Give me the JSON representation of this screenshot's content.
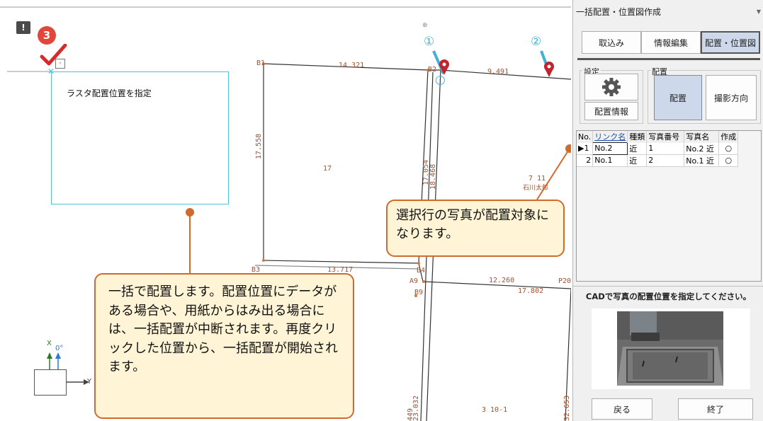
{
  "panel": {
    "title": "一括配置・位置図作成",
    "tabs": [
      "取込み",
      "情報編集",
      "配置・位置図"
    ],
    "settings_group": "設定",
    "placement_group": "配置",
    "placement_info_button": "配置情報",
    "place_button": "配置",
    "shooting_direction_button": "撮影方向",
    "grid": {
      "headers": [
        "No.",
        "リンク名",
        "種類",
        "写真番号",
        "写真名",
        "作成"
      ],
      "rows": [
        {
          "no": "▶1",
          "link": "No.2",
          "kind": "近",
          "photo_no": "1",
          "photo_name": "No.2 近",
          "made": "○"
        },
        {
          "no": "2",
          "link": "No.1",
          "kind": "近",
          "photo_no": "2",
          "photo_name": "No.1 近",
          "made": "○"
        }
      ]
    },
    "instruction": "CADで写真の配置位置を指定してください。",
    "back_button": "戻る",
    "finish_button": "終了"
  },
  "cad": {
    "placement_label": "ラスタ配置位置を指定",
    "step_number": "3",
    "pin_labels": [
      "①",
      "②"
    ],
    "axis": {
      "x": "X",
      "y": "Y",
      "angle": "0°"
    },
    "lot_labels": {
      "b1": "B1",
      "b2": "B2",
      "b3": "B3",
      "b4": "B4",
      "a9": "A9",
      "b9": "B9",
      "p20": "P20",
      "d1": "14.321",
      "d2": "9.491",
      "d3": "17.558",
      "d4": "13.717",
      "d5": "17.054",
      "d6": "18.468",
      "d7": "12.260",
      "d8": "17.802",
      "d9": "23.032",
      "d10": "449",
      "d11": "32.653",
      "lot1": "17",
      "lot2": "7 11",
      "lot3": "石川太郎",
      "lot4": "3 10-1"
    }
  },
  "callouts": {
    "selected_row": "選択行の写真が配置対象になります。",
    "batch": "一括で配置します。配置位置にデータがある場合や、用紙からはみ出る場合には、一括配置が中断されます。再度クリックした位置から、一括配置が開始されます。"
  },
  "colors": {
    "callout_border": "#d06a2d",
    "callout_fill": "#fff4d6",
    "badge": "#e0463a",
    "pin": "#c0242c"
  }
}
